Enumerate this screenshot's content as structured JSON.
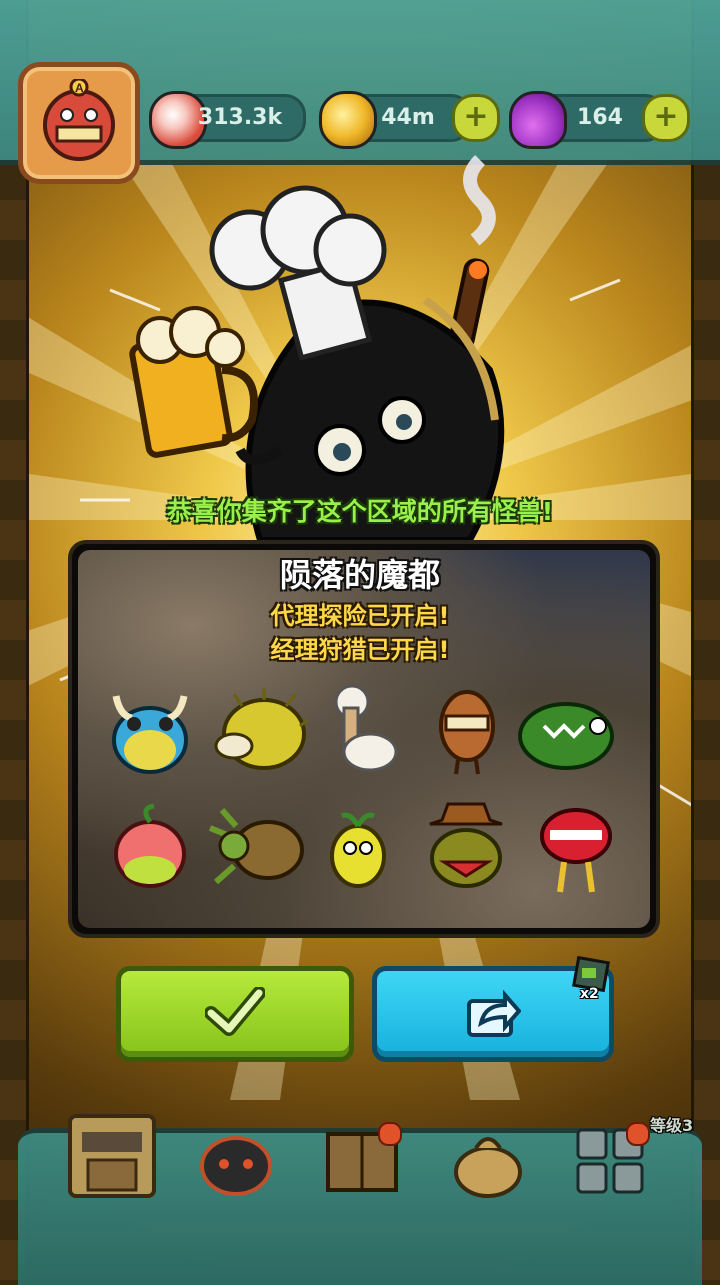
{
  "header": {
    "resources": [
      {
        "name": "eyeball",
        "value": "313.3k"
      },
      {
        "name": "coin",
        "value": "44m"
      },
      {
        "name": "potion",
        "value": "164"
      }
    ]
  },
  "popup": {
    "congrats": "恭喜你集齐了这个区域的所有怪兽!",
    "area_name": "陨落的魔都",
    "unlock_lines": [
      "代理探险已开启!",
      "经理狩猎已开启!"
    ],
    "monsters": [
      "frog-monster-icon",
      "hedgehog-monster-icon",
      "alpaca-monster-icon",
      "tiki-monster-icon",
      "crocodile-monster-icon",
      "peach-monster-icon",
      "mantis-monster-icon",
      "sprout-monster-icon",
      "cowboy-monster-icon",
      "lips-monster-icon"
    ],
    "share_badge": "x2"
  },
  "footer": {
    "level_label": "等级3"
  },
  "colors": {
    "confirm": "#9ad62a",
    "share": "#22c0e8",
    "congrats_text": "#9af04a",
    "unlock_text": "#ffd84a"
  }
}
